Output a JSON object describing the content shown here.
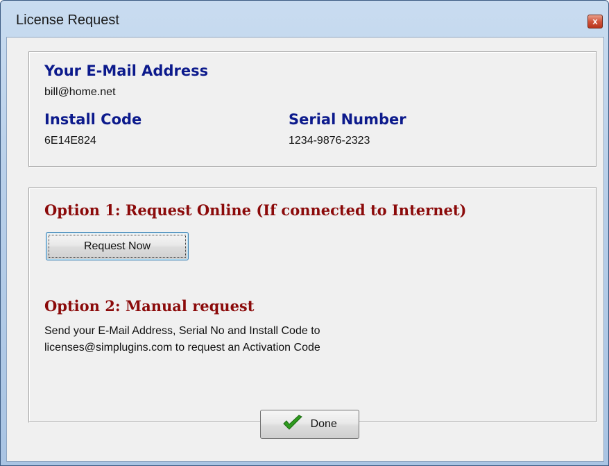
{
  "window": {
    "title": "License Request",
    "close_glyph": "x"
  },
  "info": {
    "email_label": "Your E-Mail Address",
    "email_value": "bill@home.net",
    "install_code_label": "Install Code",
    "install_code_value": "6E14E824",
    "serial_label": "Serial Number",
    "serial_value": "1234-9876-2323"
  },
  "option1": {
    "heading": "Option 1:  Request Online (If connected to Internet)",
    "button_label": "Request Now"
  },
  "option2": {
    "heading": "Option 2: Manual request",
    "line1": "Send your E-Mail Address, Serial No and Install Code to",
    "line2": "licenses@simplugins.com to request an Activation Code"
  },
  "footer": {
    "done_label": "Done",
    "done_icon": "checkmark-icon"
  },
  "colors": {
    "label_blue": "#0c1a8c",
    "label_red": "#8b0a0a",
    "check_green": "#2e9a1e"
  }
}
